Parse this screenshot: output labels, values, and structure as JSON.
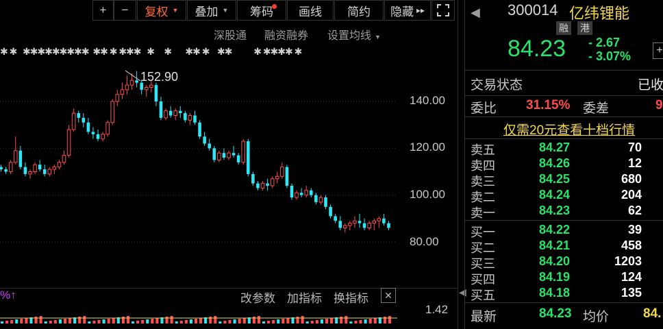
{
  "toolbar": {
    "plus": "+",
    "minus": "−",
    "fuquan": "复权",
    "diejia": "叠加",
    "chouma": "筹码",
    "huaxian": "画线",
    "jianyue": "简约",
    "yincang": "隐藏",
    "expand_arrows": "▸▸"
  },
  "subbar": {
    "shengutong": "深股通",
    "rongzi": "融资融券",
    "junxian": "设置均线"
  },
  "chart": {
    "peak_label": "152.90",
    "yticks": [
      "140.00",
      "120.00",
      "100.00",
      "80.00"
    ],
    "indicator": {
      "pct": "%↑",
      "gaicanshu": "改参数",
      "jiazhibiao": "加指标",
      "huanzhibiao": "换指标",
      "close": "✕",
      "value": "1.42"
    }
  },
  "chart_data": {
    "type": "candlestick",
    "ylim": [
      75,
      160
    ],
    "yticks": [
      80,
      100,
      120,
      140
    ],
    "peak": 152.9,
    "up_color": "#ff4d4d",
    "down_color": "#2ee6f5",
    "candles": [
      [
        112,
        113,
        110,
        111
      ],
      [
        111,
        112,
        109,
        110
      ],
      [
        110,
        115,
        109,
        114
      ],
      [
        114,
        125,
        113,
        119
      ],
      [
        119,
        121,
        111,
        112
      ],
      [
        112,
        114,
        108,
        109
      ],
      [
        109,
        111,
        107,
        110
      ],
      [
        110,
        114,
        109,
        113
      ],
      [
        113,
        115,
        110,
        111
      ],
      [
        111,
        113,
        108,
        109
      ],
      [
        109,
        112,
        108,
        111
      ],
      [
        111,
        113,
        109,
        112
      ],
      [
        112,
        115,
        111,
        114
      ],
      [
        114,
        119,
        113,
        117
      ],
      [
        117,
        130,
        116,
        128
      ],
      [
        128,
        137,
        127,
        135
      ],
      [
        135,
        136,
        131,
        133
      ],
      [
        133,
        135,
        129,
        131
      ],
      [
        131,
        133,
        126,
        127
      ],
      [
        127,
        129,
        124,
        126
      ],
      [
        126,
        128,
        123,
        124
      ],
      [
        124,
        127,
        123,
        126
      ],
      [
        126,
        132,
        125,
        131
      ],
      [
        131,
        141,
        130,
        140
      ],
      [
        140,
        145,
        138,
        143
      ],
      [
        143,
        148,
        141,
        145
      ],
      [
        145,
        151,
        143,
        147
      ],
      [
        147,
        152,
        145,
        149
      ],
      [
        149,
        153,
        146,
        148
      ],
      [
        148,
        149,
        143,
        145
      ],
      [
        145,
        147,
        142,
        146
      ],
      [
        146,
        149,
        144,
        147
      ],
      [
        147,
        148,
        138,
        140
      ],
      [
        140,
        142,
        132,
        133
      ],
      [
        133,
        137,
        132,
        136
      ],
      [
        136,
        138,
        133,
        134
      ],
      [
        134,
        137,
        132,
        136
      ],
      [
        136,
        138,
        133,
        135
      ],
      [
        135,
        136,
        131,
        132
      ],
      [
        132,
        135,
        130,
        134
      ],
      [
        134,
        136,
        130,
        131
      ],
      [
        131,
        132,
        124,
        125
      ],
      [
        125,
        127,
        121,
        122
      ],
      [
        122,
        124,
        119,
        120
      ],
      [
        120,
        121,
        114,
        115
      ],
      [
        115,
        119,
        114,
        118
      ],
      [
        118,
        120,
        115,
        116
      ],
      [
        116,
        119,
        115,
        118
      ],
      [
        118,
        121,
        116,
        117
      ],
      [
        117,
        118,
        113,
        114
      ],
      [
        114,
        124,
        113,
        123
      ],
      [
        123,
        124,
        108,
        109
      ],
      [
        109,
        110,
        104,
        105
      ],
      [
        105,
        106,
        102,
        103
      ],
      [
        103,
        106,
        102,
        105
      ],
      [
        105,
        107,
        102,
        104
      ],
      [
        104,
        108,
        103,
        107
      ],
      [
        107,
        110,
        105,
        108
      ],
      [
        108,
        114,
        107,
        112
      ],
      [
        112,
        113,
        103,
        104
      ],
      [
        104,
        105,
        98,
        99
      ],
      [
        99,
        102,
        98,
        101
      ],
      [
        101,
        103,
        99,
        100
      ],
      [
        100,
        104,
        99,
        102
      ],
      [
        102,
        103,
        99,
        100
      ],
      [
        100,
        101,
        96,
        97
      ],
      [
        97,
        100,
        96,
        99
      ],
      [
        99,
        100,
        94,
        95
      ],
      [
        95,
        96,
        90,
        91
      ],
      [
        91,
        92,
        88,
        89
      ],
      [
        89,
        91,
        85,
        86
      ],
      [
        86,
        88,
        84,
        87
      ],
      [
        87,
        89,
        85,
        88
      ],
      [
        88,
        91,
        86,
        89
      ],
      [
        89,
        92,
        86,
        88
      ],
      [
        88,
        90,
        85,
        86
      ],
      [
        86,
        89,
        85,
        88
      ],
      [
        88,
        90,
        85,
        89
      ],
      [
        89,
        91,
        86,
        90
      ],
      [
        90,
        92,
        87,
        88
      ],
      [
        88,
        89,
        85,
        86
      ]
    ]
  },
  "quote": {
    "code": "300014",
    "name": "亿纬锂能",
    "badge1": "融",
    "badge2": "港",
    "price": "84.23",
    "change": "- 2.67",
    "change_pct": "- 3.07%",
    "status_label": "交易状态",
    "status_value": "已收",
    "weibi_label": "委比",
    "weibi_value": "31.15%",
    "weicha_label": "委差",
    "weicha_value": "9",
    "promo": "仅需20元查看十档行情",
    "sells": [
      {
        "label": "卖五",
        "price": "84.27",
        "vol": "70"
      },
      {
        "label": "卖四",
        "price": "84.26",
        "vol": "12"
      },
      {
        "label": "卖三",
        "price": "84.25",
        "vol": "680"
      },
      {
        "label": "卖二",
        "price": "84.24",
        "vol": "204"
      },
      {
        "label": "卖一",
        "price": "84.23",
        "vol": "62"
      }
    ],
    "buys": [
      {
        "label": "买一",
        "price": "84.22",
        "vol": "39"
      },
      {
        "label": "买二",
        "price": "84.21",
        "vol": "458"
      },
      {
        "label": "买三",
        "price": "84.20",
        "vol": "1203"
      },
      {
        "label": "买四",
        "price": "84.19",
        "vol": "124"
      },
      {
        "label": "买五",
        "price": "84.18",
        "vol": "135"
      }
    ],
    "latest_label": "最新",
    "latest_value": "84.23",
    "avg_label": "均价",
    "avg_value": "84."
  },
  "colors": {
    "up": "#ff4d4d",
    "down": "#27e36a",
    "accent_orange": "#ff6a3d",
    "promo_yellow": "#f3d84b"
  }
}
